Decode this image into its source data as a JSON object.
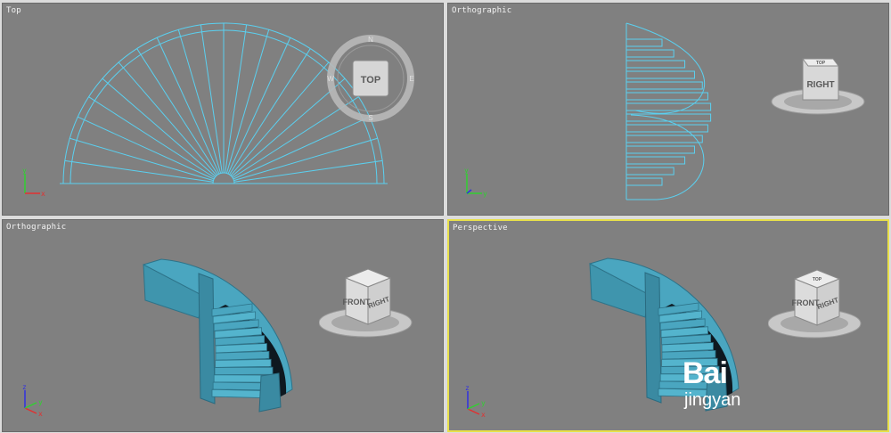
{
  "viewports": {
    "top_left": {
      "label": "Top",
      "cube_face": "TOP",
      "compass": [
        "N",
        "E",
        "S",
        "W"
      ]
    },
    "top_right": {
      "label": "Orthographic",
      "cube_face": "RIGHT",
      "cube_top": "TOP"
    },
    "bottom_left": {
      "label": "Orthographic",
      "cube_front": "FRONT",
      "cube_right": "RIGHT"
    },
    "bottom_right": {
      "label": "Perspective",
      "cube_front": "FRONT",
      "cube_right": "RIGHT",
      "cube_top": "TOP",
      "active": true
    }
  },
  "axes": {
    "x": "x",
    "y": "y",
    "z": "z"
  },
  "watermark": {
    "line1": "Bai",
    "line2": "jingyan"
  },
  "colors": {
    "viewport_bg": "#808080",
    "wire": "#5ad0f0",
    "stair_fill": "#4aa6c0",
    "active_border": "#e8e04a",
    "axis_x": "#e23030",
    "axis_y": "#30d030",
    "axis_z": "#3030e0"
  }
}
